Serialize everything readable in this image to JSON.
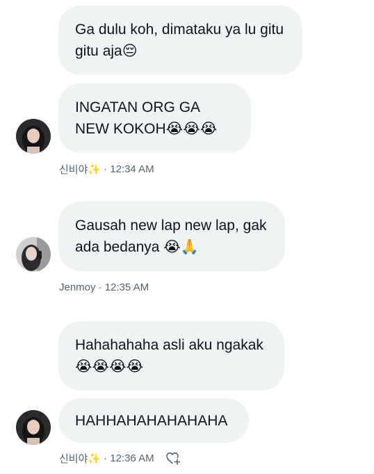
{
  "messages": [
    {
      "text": "Ga dulu koh, dimataku ya lu gitu gitu aja😔"
    },
    {
      "text": "INGATAN ORG GA NEW KOKOH😭😭😭"
    },
    {
      "text": "Gausah new lap new lap, gak ada bedanya 😭🙏"
    },
    {
      "text": "Hahahahaha asli aku ngakak 😭😭😭😭"
    },
    {
      "text": "HAHHAHAHAHAHAHA"
    }
  ],
  "meta": [
    {
      "sender": "신비야✨",
      "time": "· 12:34 AM"
    },
    {
      "sender": "Jenmoy",
      "time": "· 12:35 AM"
    },
    {
      "sender": "신비야✨",
      "time": "· 12:36 AM"
    }
  ],
  "icons": {
    "heart_plus": "heart-plus-icon"
  },
  "colors": {
    "bubble_bg": "#eff3f4",
    "text": "#0f1419",
    "meta_text": "#536471"
  }
}
